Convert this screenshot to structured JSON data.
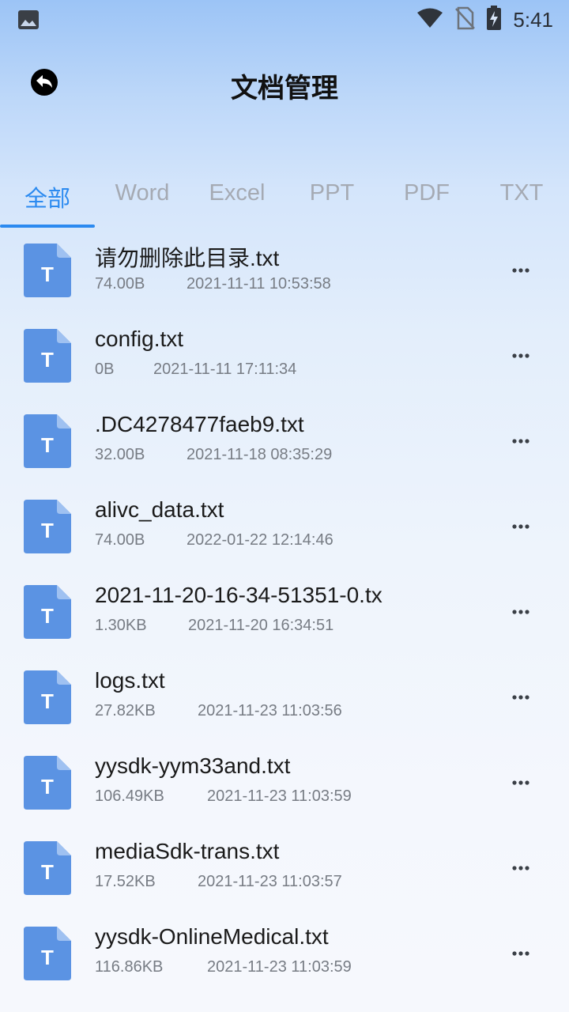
{
  "status_bar": {
    "time": "5:41",
    "icons": [
      "image-notification-icon",
      "wifi-icon",
      "no-sim-icon",
      "battery-charging-icon"
    ]
  },
  "header": {
    "title": "文档管理",
    "back_icon": "back-arrow-icon"
  },
  "tabs": [
    {
      "label": "全部",
      "active": true
    },
    {
      "label": "Word",
      "active": false
    },
    {
      "label": "Excel",
      "active": false
    },
    {
      "label": "PPT",
      "active": false
    },
    {
      "label": "PDF",
      "active": false
    },
    {
      "label": "TXT",
      "active": false
    }
  ],
  "colors": {
    "accent": "#2b8af0",
    "file_icon": "#5b93e3",
    "text_muted": "#777c84"
  },
  "files": [
    {
      "name": "请勿删除此目录.txt",
      "size": "74.00B",
      "date": "2021-11-11 10:53:58",
      "icon_letter": "T"
    },
    {
      "name": "config.txt",
      "size": "0B",
      "date": "2021-11-11 17:11:34",
      "icon_letter": "T"
    },
    {
      "name": ".DC4278477faeb9.txt",
      "size": "32.00B",
      "date": "2021-11-18 08:35:29",
      "icon_letter": "T"
    },
    {
      "name": "alivc_data.txt",
      "size": "74.00B",
      "date": "2022-01-22 12:14:46",
      "icon_letter": "T"
    },
    {
      "name": "2021-11-20-16-34-51351-0.tx",
      "size": "1.30KB",
      "date": "2021-11-20 16:34:51",
      "icon_letter": "T"
    },
    {
      "name": "logs.txt",
      "size": "27.82KB",
      "date": "2021-11-23 11:03:56",
      "icon_letter": "T"
    },
    {
      "name": "yysdk-yym33and.txt",
      "size": "106.49KB",
      "date": "2021-11-23 11:03:59",
      "icon_letter": "T"
    },
    {
      "name": "mediaSdk-trans.txt",
      "size": "17.52KB",
      "date": "2021-11-23 11:03:57",
      "icon_letter": "T"
    },
    {
      "name": "yysdk-OnlineMedical.txt",
      "size": "116.86KB",
      "date": "2021-11-23 11:03:59",
      "icon_letter": "T"
    }
  ]
}
